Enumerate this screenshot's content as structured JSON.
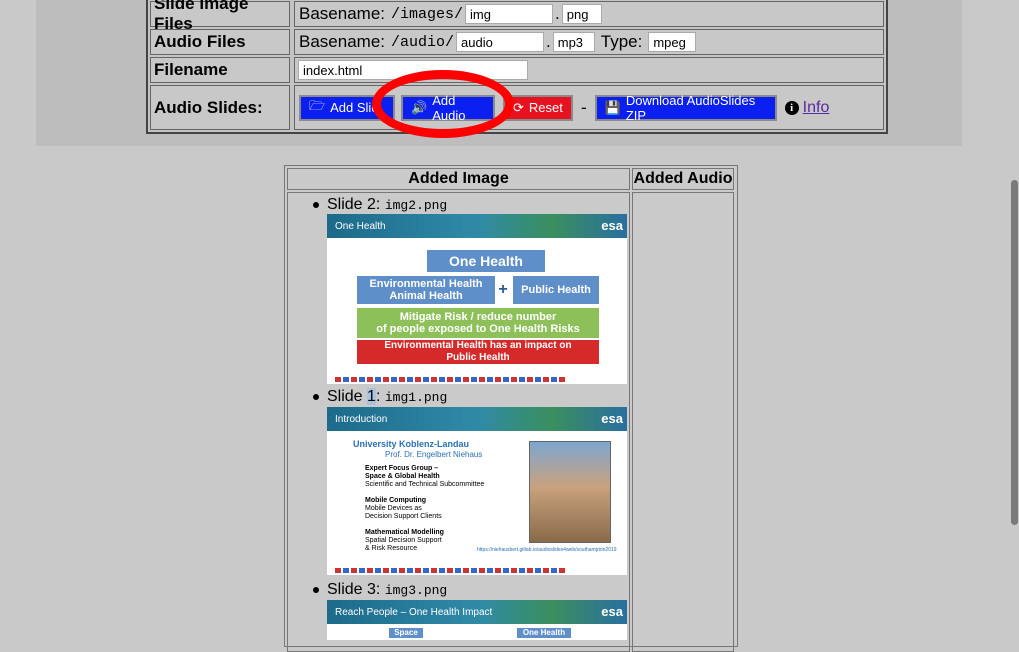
{
  "config": {
    "slide_image_files": {
      "label": "Slide Image Files",
      "basename_label": "Basename:",
      "path": "/images/",
      "basename_value": "img",
      "dot": ".",
      "ext_value": "png"
    },
    "audio_files": {
      "label": "Audio Files",
      "basename_label": "Basename:",
      "path": "/audio/",
      "basename_value": "audio",
      "dot": ".",
      "ext_value": "mp3",
      "type_label": "Type:",
      "type_value": "mpeg"
    },
    "filename": {
      "label": "Filename",
      "value": "index.html"
    },
    "audio_slides": {
      "label": "Audio Slides:",
      "add_slide_label": "Add Slid",
      "add_audio_label": "Add Audio",
      "reset_label": "Reset",
      "separator": "-",
      "download_label": "Download AudioSlides ZIP",
      "info_label": "Info"
    }
  },
  "colors": {
    "button_blue": "#0a1ff0",
    "button_red": "#e6121f",
    "annotation_circle": "#ff0000"
  },
  "list": {
    "header_image": "Added Image",
    "header_audio": "Added Audio",
    "slides": [
      {
        "label": "Slide 2:",
        "file": "img2.png",
        "title": "One Health",
        "logo": "esa",
        "boxes": {
          "top": "One Health",
          "env": "Environmental Health\nAnimal Health",
          "plus": "+",
          "public": "Public Health",
          "mitigate": "Mitigate Risk / reduce number\nof people exposed to One Health Risks",
          "impact": "Environmental Health has an impact on\nPublic Health"
        }
      },
      {
        "label_prefix": "Slide ",
        "label_num": "1",
        "label_suffix": ":",
        "file": "img1.png",
        "title": "Introduction",
        "logo": "esa",
        "uni": "University Koblenz-Landau",
        "prof": "Prof. Dr. Engelbert Niehaus",
        "items": [
          {
            "head": "Expert Focus Group –\nSpace & Global Health",
            "sub": "Scientific and Technical Subcommittee"
          },
          {
            "head": "Mobile Computing",
            "sub": "Mobile Devices as\nDecision Support Clients"
          },
          {
            "head": "Mathematical Modelling",
            "sub": "Spatial Decision Support\n& Risk Resource"
          }
        ],
        "url": "https://niehausbert.gitlab.io/audioslides4web/southampton2019"
      },
      {
        "label": "Slide 3:",
        "file": "img3.png",
        "title": "Reach People – One Health Impact",
        "logo": "esa",
        "box_left": "Space",
        "box_right": "One Health"
      }
    ]
  }
}
